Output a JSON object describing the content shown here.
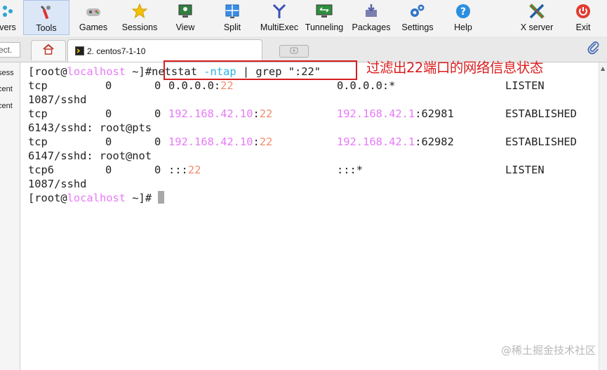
{
  "toolbar": {
    "items": [
      {
        "label": "vers",
        "icon": "servers-icon"
      },
      {
        "label": "Tools",
        "icon": "tools-icon"
      },
      {
        "label": "Games",
        "icon": "games-icon"
      },
      {
        "label": "Sessions",
        "icon": "star-icon"
      },
      {
        "label": "View",
        "icon": "view-icon"
      },
      {
        "label": "Split",
        "icon": "split-icon"
      },
      {
        "label": "MultiExec",
        "icon": "multiexec-icon"
      },
      {
        "label": "Tunneling",
        "icon": "tunneling-icon"
      },
      {
        "label": "Packages",
        "icon": "packages-icon"
      },
      {
        "label": "Settings",
        "icon": "gears-icon"
      },
      {
        "label": "Help",
        "icon": "help-icon"
      },
      {
        "label": "X server",
        "icon": "x-server-icon"
      },
      {
        "label": "Exit",
        "icon": "power-icon"
      }
    ]
  },
  "tabs": {
    "quick_connect": "ect.",
    "session_tab_label": "2. centos7-1-10"
  },
  "left_panel": {
    "items": [
      "sess",
      "cent",
      "cent"
    ]
  },
  "terminal": {
    "prompt_user": "[root@",
    "prompt_host": "localhost",
    "prompt_tail": " ~]#",
    "cmd_name": "netstat",
    "cmd_flag": "-ntap",
    "cmd_rest": " | grep \":22\"",
    "rows": [
      {
        "proto": "tcp",
        "recv": "0",
        "send": "0",
        "local_ip": "0.0.0.0",
        "local_port": "22",
        "foreign": "0.0.0.0:*",
        "state": "LISTEN",
        "pid": "1087/sshd"
      },
      {
        "proto": "tcp",
        "recv": "0",
        "send": "0",
        "local_ip": "192.168.42.10",
        "local_port": "22",
        "foreign_ip": "192.168.42.1",
        "foreign_port": "62981",
        "state": "ESTABLISHED",
        "pid": "6143/sshd: root@pts"
      },
      {
        "proto": "tcp",
        "recv": "0",
        "send": "0",
        "local_ip": "192.168.42.10",
        "local_port": "22",
        "foreign_ip": "192.168.42.1",
        "foreign_port": "62982",
        "state": "ESTABLISHED",
        "pid": "6147/sshd: root@not"
      },
      {
        "proto": "tcp6",
        "recv": "0",
        "send": "0",
        "local_ip": "::",
        "local_port": "22",
        "foreign": ":::*",
        "state": "LISTEN",
        "pid": "1087/sshd"
      }
    ]
  },
  "annotation": "过滤出22端口的网络信息状态",
  "watermark": "@稀土掘金技术社区",
  "colors": {
    "annotation_red": "#d81e1e",
    "host_magenta": "#e879f9",
    "flag_cyan": "#2ab3e6",
    "port_orange": "#f28c6b"
  }
}
